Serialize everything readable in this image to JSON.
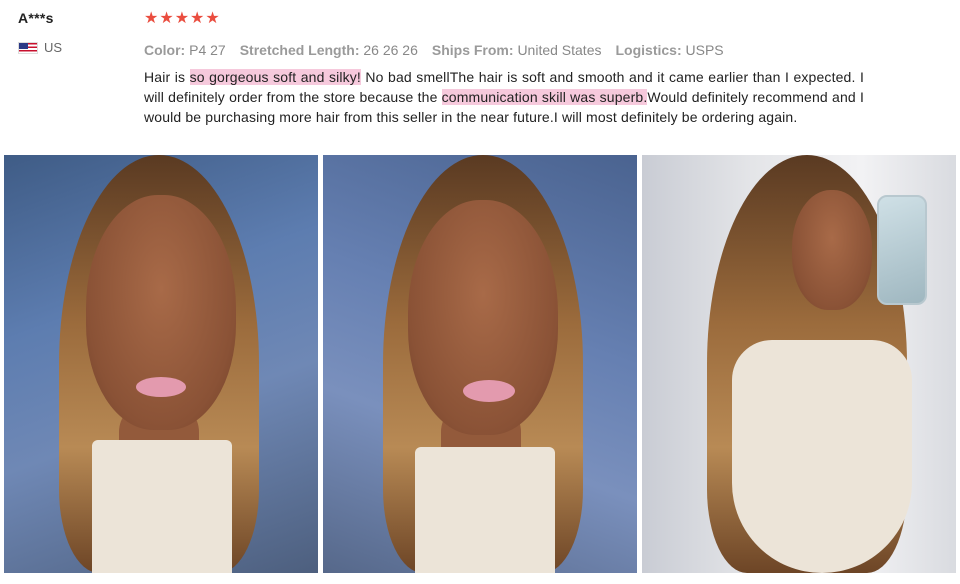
{
  "reviewer": {
    "name": "A***s",
    "country": "US",
    "flag_icon": "us-flag-icon"
  },
  "rating": {
    "stars": 5,
    "max": 5,
    "color": "#ea4d3f"
  },
  "meta": {
    "color_label": "Color:",
    "color_value": "P4 27",
    "length_label": "Stretched Length:",
    "length_value": "26 26 26",
    "ships_label": "Ships From:",
    "ships_value": "United States",
    "logistics_label": "Logistics:",
    "logistics_value": "USPS"
  },
  "review_text": {
    "part1": "Hair is ",
    "highlight1": "so gorgeous soft and silky!",
    "part2": " No bad smellThe hair is soft and smooth and it came earlier than I expected. I will definitely order from the store because the ",
    "highlight2": "communication skill was superb.",
    "part3": "Would definitely recommend and I would be purchasing more hair from this seller in the near future.I will most definitely be ordering again."
  },
  "highlight_color": "#f6c9dc"
}
